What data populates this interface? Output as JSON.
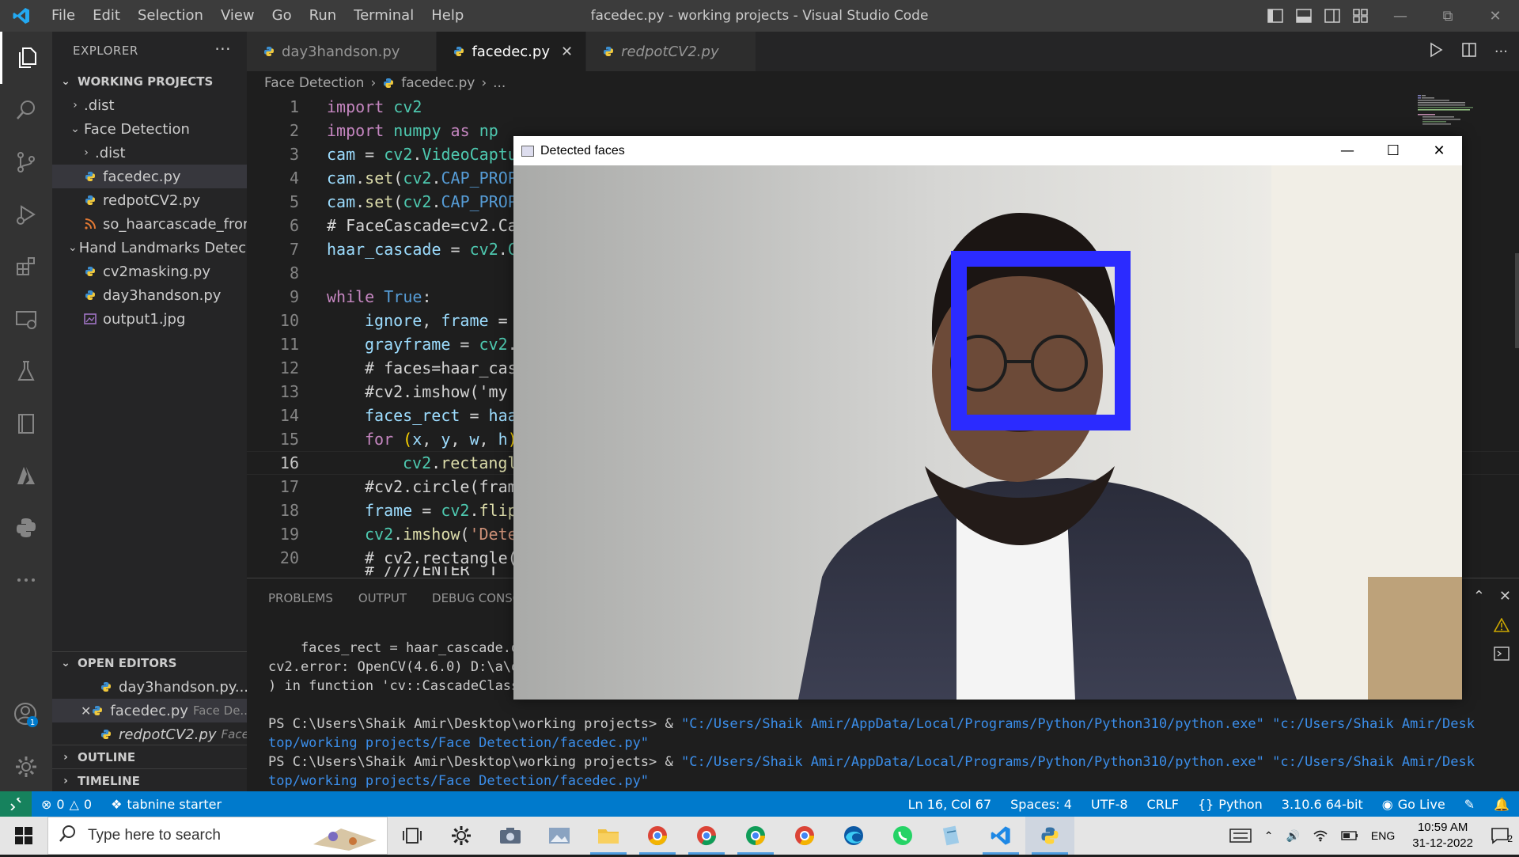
{
  "window_title": "facedec.py - working projects - Visual Studio Code",
  "menu": [
    "File",
    "Edit",
    "Selection",
    "View",
    "Go",
    "Run",
    "Terminal",
    "Help"
  ],
  "sidebar": {
    "title": "EXPLORER",
    "more": "···",
    "root": "WORKING PROJECTS",
    "tree": [
      {
        "label": ".dist",
        "type": "folder",
        "level": 0,
        "expanded": false
      },
      {
        "label": "Face Detection",
        "type": "folder",
        "level": 0,
        "expanded": true
      },
      {
        "label": ".dist",
        "type": "folder",
        "level": 1,
        "expanded": false
      },
      {
        "label": "facedec.py",
        "type": "python",
        "level": 1,
        "selected": true
      },
      {
        "label": "redpotCV2.py",
        "type": "python",
        "level": 1
      },
      {
        "label": "so_haarcascade_fronta...",
        "type": "xml",
        "level": 1
      },
      {
        "label": "Hand Landmarks Detec...",
        "type": "folder",
        "level": 0,
        "expanded": true
      },
      {
        "label": "cv2masking.py",
        "type": "python",
        "level": 1
      },
      {
        "label": "day3handson.py",
        "type": "python",
        "level": 1
      },
      {
        "label": "output1.jpg",
        "type": "image",
        "level": 1
      }
    ],
    "open_editors_title": "OPEN EDITORS",
    "open_editors": [
      {
        "label": "day3handson.py...",
        "desc": ""
      },
      {
        "label": "facedec.py",
        "desc": "Face De..."
      },
      {
        "label": "redpotCV2.py",
        "desc": "Face..."
      }
    ],
    "outline": "OUTLINE",
    "timeline": "TIMELINE"
  },
  "tabs": [
    {
      "label": "day3handson.py",
      "active": false,
      "italic": false
    },
    {
      "label": "facedec.py",
      "active": true,
      "italic": false
    },
    {
      "label": "redpotCV2.py",
      "active": false,
      "italic": true
    }
  ],
  "breadcrumb": [
    "Face Detection",
    "facedec.py",
    "..."
  ],
  "code_lines": [
    "1",
    "2",
    "3",
    "4",
    "5",
    "6",
    "7",
    "8",
    "9",
    "10",
    "11",
    "12",
    "13",
    "14",
    "15",
    "16",
    "17",
    "18",
    "19",
    "20"
  ],
  "code": {
    "l1": [
      "import",
      " ",
      "cv2"
    ],
    "l2": [
      "import",
      " ",
      "numpy",
      " as ",
      "np"
    ],
    "l3": [
      "cam",
      " = ",
      "cv2",
      ".",
      "VideoCaptu"
    ],
    "l4": [
      "cam",
      ".",
      "set",
      "(",
      "cv2",
      ".",
      "CAP_PROP"
    ],
    "l5": [
      "cam",
      ".",
      "set",
      "(",
      "cv2",
      ".",
      "CAP_PROP"
    ],
    "l6": "# FaceCascade=cv2.Ca",
    "l7": [
      "haar_cascade",
      " = ",
      "cv2",
      ".",
      "C"
    ],
    "l9": [
      "while",
      " ",
      "True",
      ":"
    ],
    "l10": [
      "ignore",
      ", ",
      "frame",
      " = "
    ],
    "l11": [
      "grayframe",
      " = ",
      "cv2",
      "."
    ],
    "l12": "# faces=haar_cas",
    "l13": "#cv2.imshow('my",
    "l14": [
      "faces_rect",
      " = ",
      "haa"
    ],
    "l15": [
      "for",
      " (",
      "x",
      ", ",
      "y",
      ", ",
      "w",
      ", ",
      "h",
      ")"
    ],
    "l16": [
      "cv2",
      ".",
      "rectangl"
    ],
    "l17": "#cv2.circle(fram",
    "l18": [
      "frame",
      " = ",
      "cv2",
      ".",
      "flip"
    ],
    "l19": [
      "cv2",
      ".",
      "imshow",
      "(",
      "'Dete"
    ],
    "l20": "# cv2.rectangle(",
    "l21": "# ////ENTER  T"
  },
  "panel": {
    "tabs": [
      "PROBLEMS",
      "OUTPUT",
      "DEBUG CONSOLE"
    ],
    "terminal": [
      "    faces_rect = haar_cascade.d",
      "cv2.error: OpenCV(4.6.0) D:\\a\\o",
      ") in function 'cv::CascadeClass"
    ],
    "prompt": "PS C:\\Users\\Shaik Amir\\Desktop\\working projects> & ",
    "cmd_part1": "\"C:/Users/Shaik Amir/AppData/Local/Programs/Python/Python310/python.exe\" \"c:/Users/Shaik Amir/Desk",
    "cmd_part2": "top/working projects/Face Detection/facedec.py\""
  },
  "status": {
    "errors": "0",
    "warnings": "0",
    "tabnine": "tabnine starter",
    "position": "Ln 16, Col 67",
    "spaces": "Spaces: 4",
    "encoding": "UTF-8",
    "eol": "CRLF",
    "language": "Python",
    "interpreter": "3.10.6 64-bit",
    "golive": "Go Live",
    "account_badge": "1"
  },
  "cv_window": {
    "title": "Detected faces"
  },
  "taskbar": {
    "search_placeholder": "Type here to search",
    "lang": "ENG",
    "time": "10:59 AM",
    "date": "31-12-2022",
    "notif_badge": "2"
  },
  "colors": {
    "vscode_blue": "#007acc",
    "detection_box": "#2b2bff",
    "titlebar": "#3c3c3c",
    "editor_bg": "#1e1e1e"
  }
}
